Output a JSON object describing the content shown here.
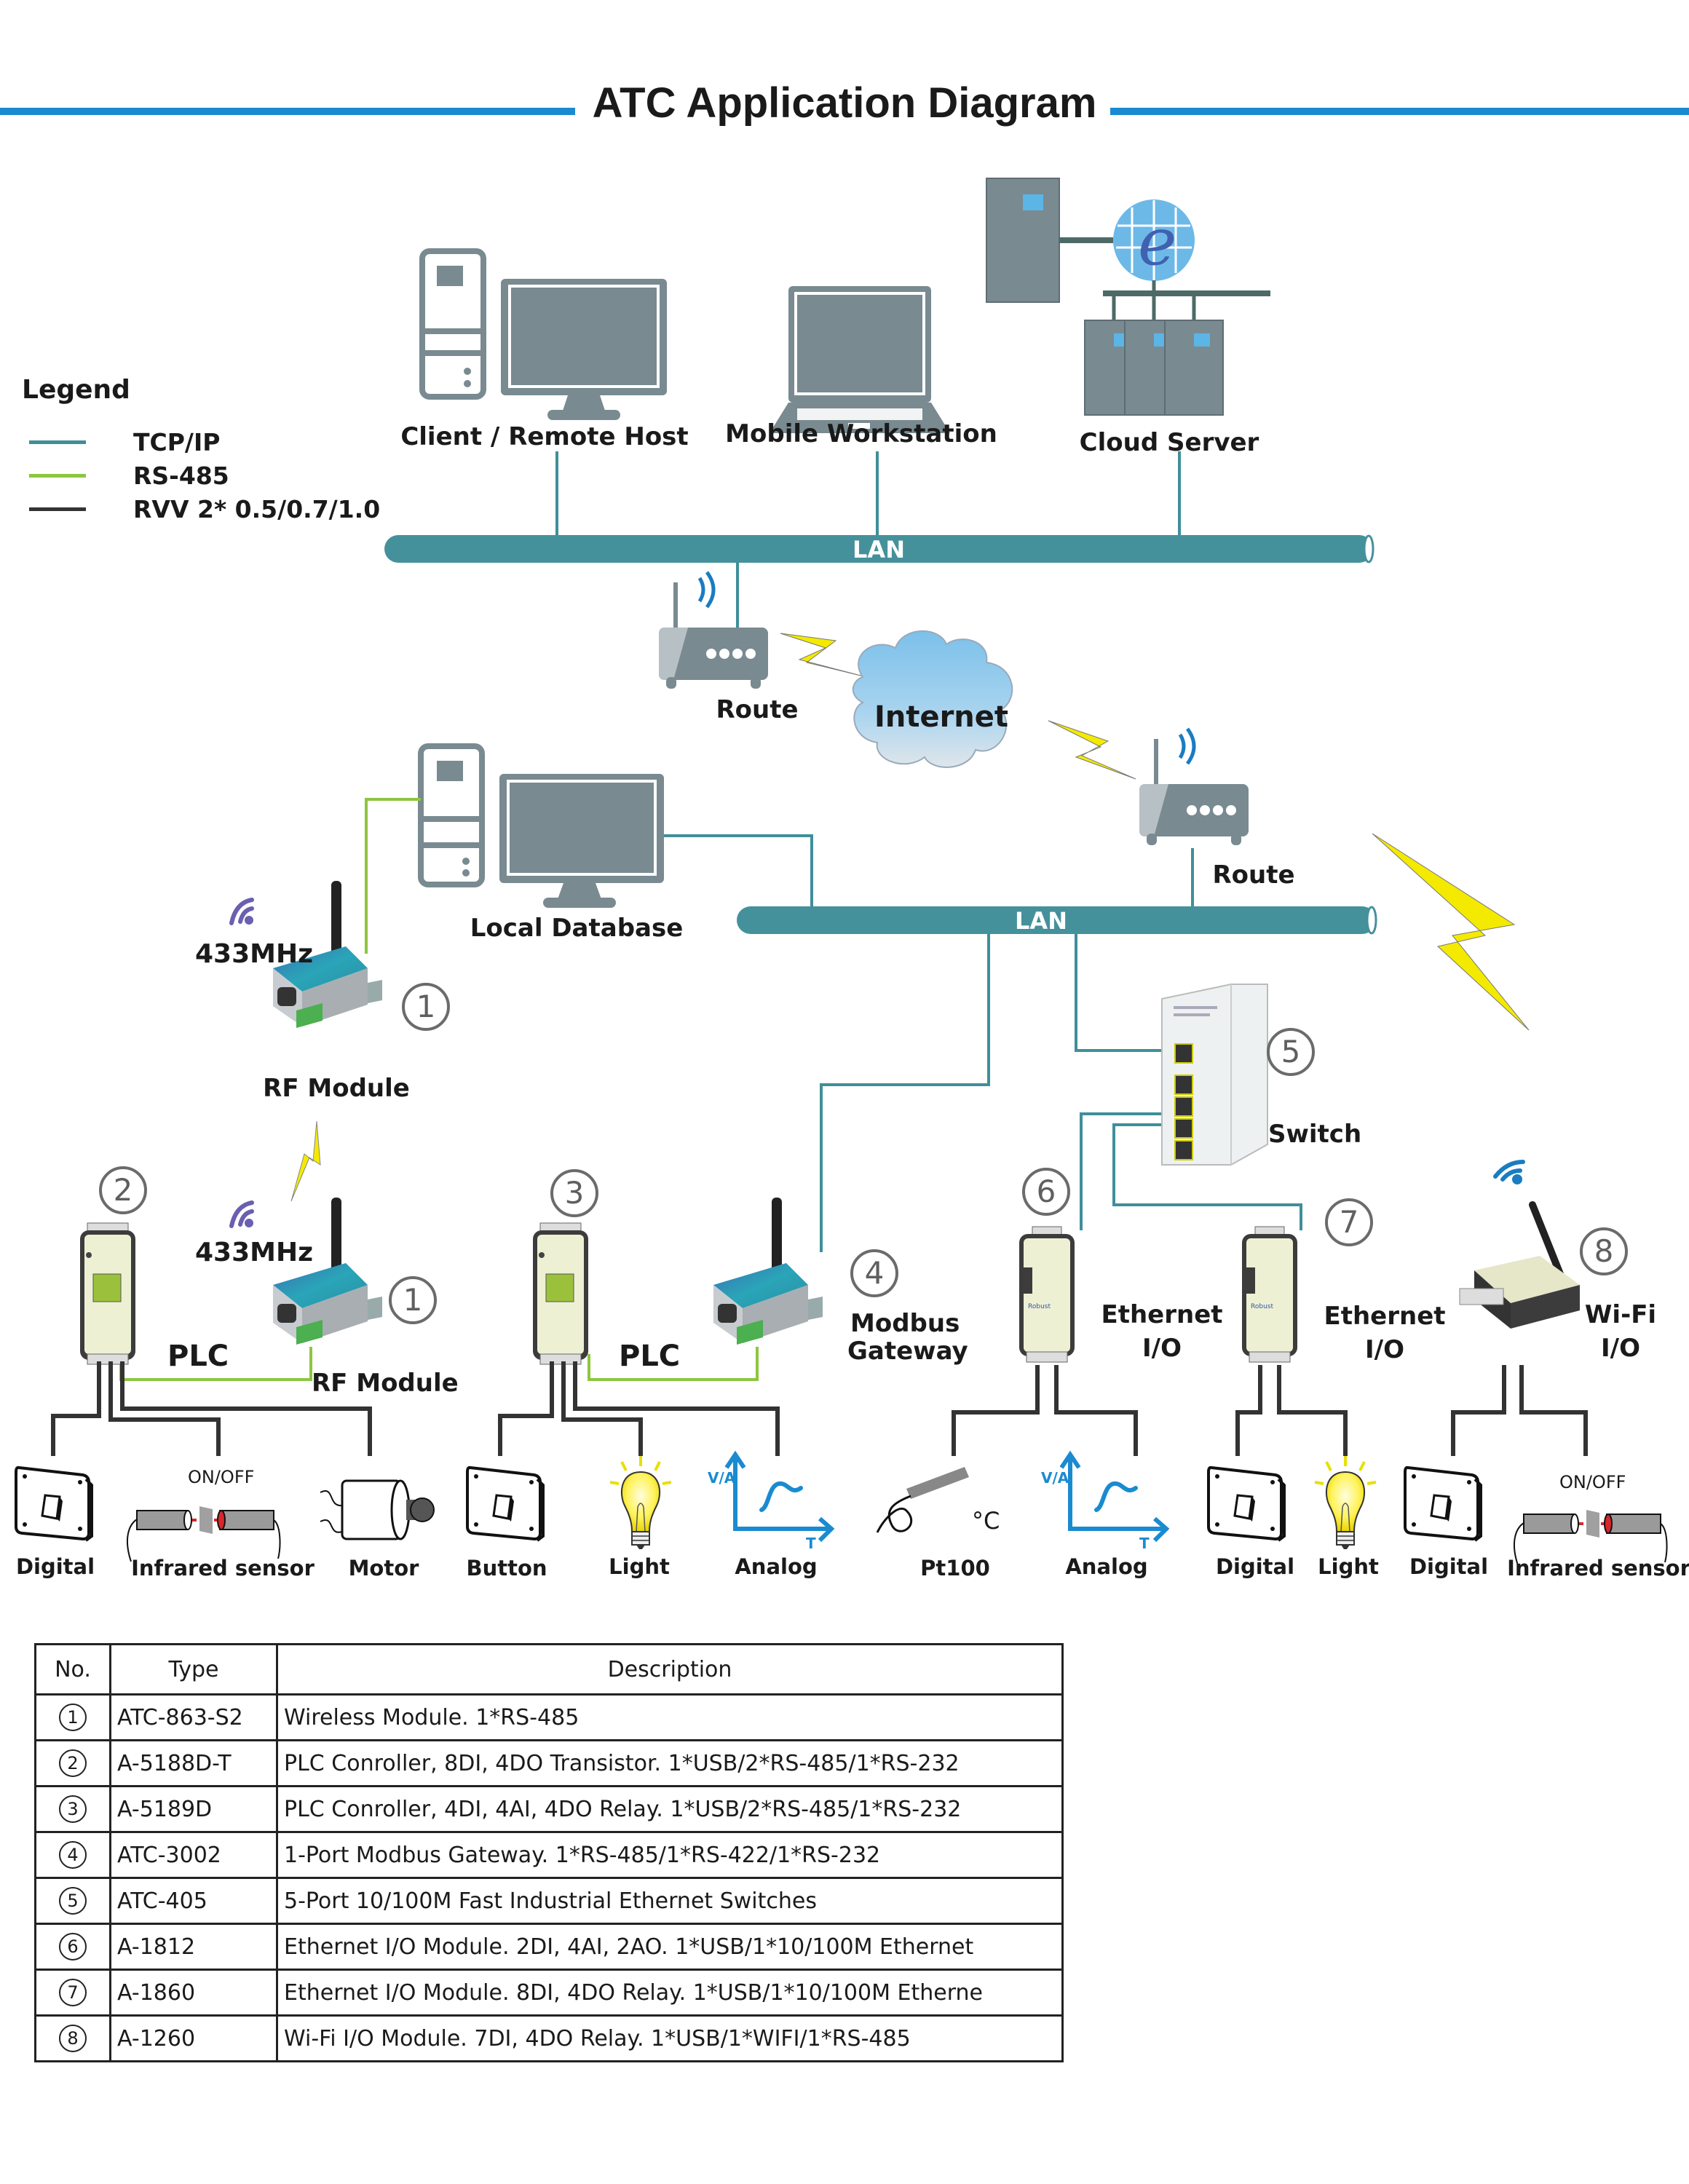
{
  "title": "ATC Application Diagram",
  "colors": {
    "title_rule": "#1a8bd0",
    "tcp_ip": "#3f8f9a",
    "rs485": "#8cc63f",
    "rvv": "#333333",
    "lan_bar": "#44919b",
    "device_gray": "#798a91",
    "lightning": "#f4ea00",
    "analog_blue": "#1a8bd0"
  },
  "legend": {
    "title": "Legend",
    "items": [
      {
        "label": "TCP/IP",
        "line": "tcp_ip"
      },
      {
        "label": "RS-485",
        "line": "rs485"
      },
      {
        "label": "RVV 2* 0.5/0.7/1.0",
        "line": "rvv"
      }
    ]
  },
  "top_network": {
    "nodes": [
      {
        "id": "client",
        "label": "Client / Remote Host",
        "icon": "desktop-computer-icon"
      },
      {
        "id": "mobile",
        "label": "Mobile Workstation",
        "icon": "laptop-icon"
      },
      {
        "id": "cloud",
        "label": "Cloud Server",
        "icon": "server-cluster-icon"
      }
    ],
    "lan_label": "LAN",
    "router_label": "Route",
    "internet_label": "Internet"
  },
  "site_network": {
    "router_label": "Route",
    "lan_label": "LAN",
    "local_db_label": "Local Database",
    "switch_label": "Switch",
    "rf_freq": "433MHz",
    "rf_module_label": "RF Module",
    "plc_label": "PLC",
    "modbus_label_1": "Modbus",
    "modbus_label_2": "Gateway",
    "eth_io_label_1": "Ethernet",
    "eth_io_label_2": "I/O",
    "wifi_io_label_1": "Wi-Fi",
    "wifi_io_label_2": "I/O"
  },
  "badges": [
    "1",
    "1",
    "2",
    "3",
    "4",
    "5",
    "6",
    "7",
    "8"
  ],
  "field_devices": [
    {
      "label": "Digital",
      "icon": "switch-icon"
    },
    {
      "label": "Infrared sensor",
      "icon": "infrared-sensor-icon",
      "caption": "ON/OFF"
    },
    {
      "label": "Motor",
      "icon": "motor-icon"
    },
    {
      "label": "Button",
      "icon": "switch-icon"
    },
    {
      "label": "Light",
      "icon": "light-bulb-icon"
    },
    {
      "label": "Analog",
      "icon": "analog-graph-icon",
      "axis_y": "V/A",
      "axis_x": "T"
    },
    {
      "label": "Pt100",
      "icon": "temperature-probe-icon",
      "unit": "°C"
    },
    {
      "label": "Analog",
      "icon": "analog-graph-icon",
      "axis_y": "V/A",
      "axis_x": "T"
    },
    {
      "label": "Digital",
      "icon": "switch-icon"
    },
    {
      "label": "Light",
      "icon": "light-bulb-icon"
    },
    {
      "label": "Digital",
      "icon": "switch-icon"
    },
    {
      "label": "Infrared sensor",
      "icon": "infrared-sensor-icon",
      "caption": "ON/OFF"
    }
  ],
  "switch_text": {
    "on": "ON",
    "off": "OFF"
  },
  "table": {
    "headers": [
      "No.",
      "Type",
      "Description"
    ],
    "rows": [
      {
        "no": "1",
        "type": "ATC-863-S2",
        "desc": "Wireless Module. 1*RS-485"
      },
      {
        "no": "2",
        "type": "A-5188D-T",
        "desc": "PLC Conroller, 8DI, 4DO Transistor. 1*USB/2*RS-485/1*RS-232"
      },
      {
        "no": "3",
        "type": "A-5189D",
        "desc": "PLC Conroller, 4DI, 4AI, 4DO Relay. 1*USB/2*RS-485/1*RS-232"
      },
      {
        "no": "4",
        "type": "ATC-3002",
        "desc": "1-Port Modbus Gateway. 1*RS-485/1*RS-422/1*RS-232"
      },
      {
        "no": "5",
        "type": "ATC-405",
        "desc": "5-Port 10/100M Fast Industrial Ethernet Switches"
      },
      {
        "no": "6",
        "type": "A-1812",
        "desc": "Ethernet I/O Module. 2DI, 4AI, 2AO. 1*USB/1*10/100M Ethernet"
      },
      {
        "no": "7",
        "type": "A-1860",
        "desc": "Ethernet I/O Module. 8DI, 4DO Relay. 1*USB/1*10/100M Etherne"
      },
      {
        "no": "8",
        "type": "A-1260",
        "desc": "Wi-Fi I/O Module. 7DI, 4DO Relay. 1*USB/1*WIFI/1*RS-485"
      }
    ]
  }
}
